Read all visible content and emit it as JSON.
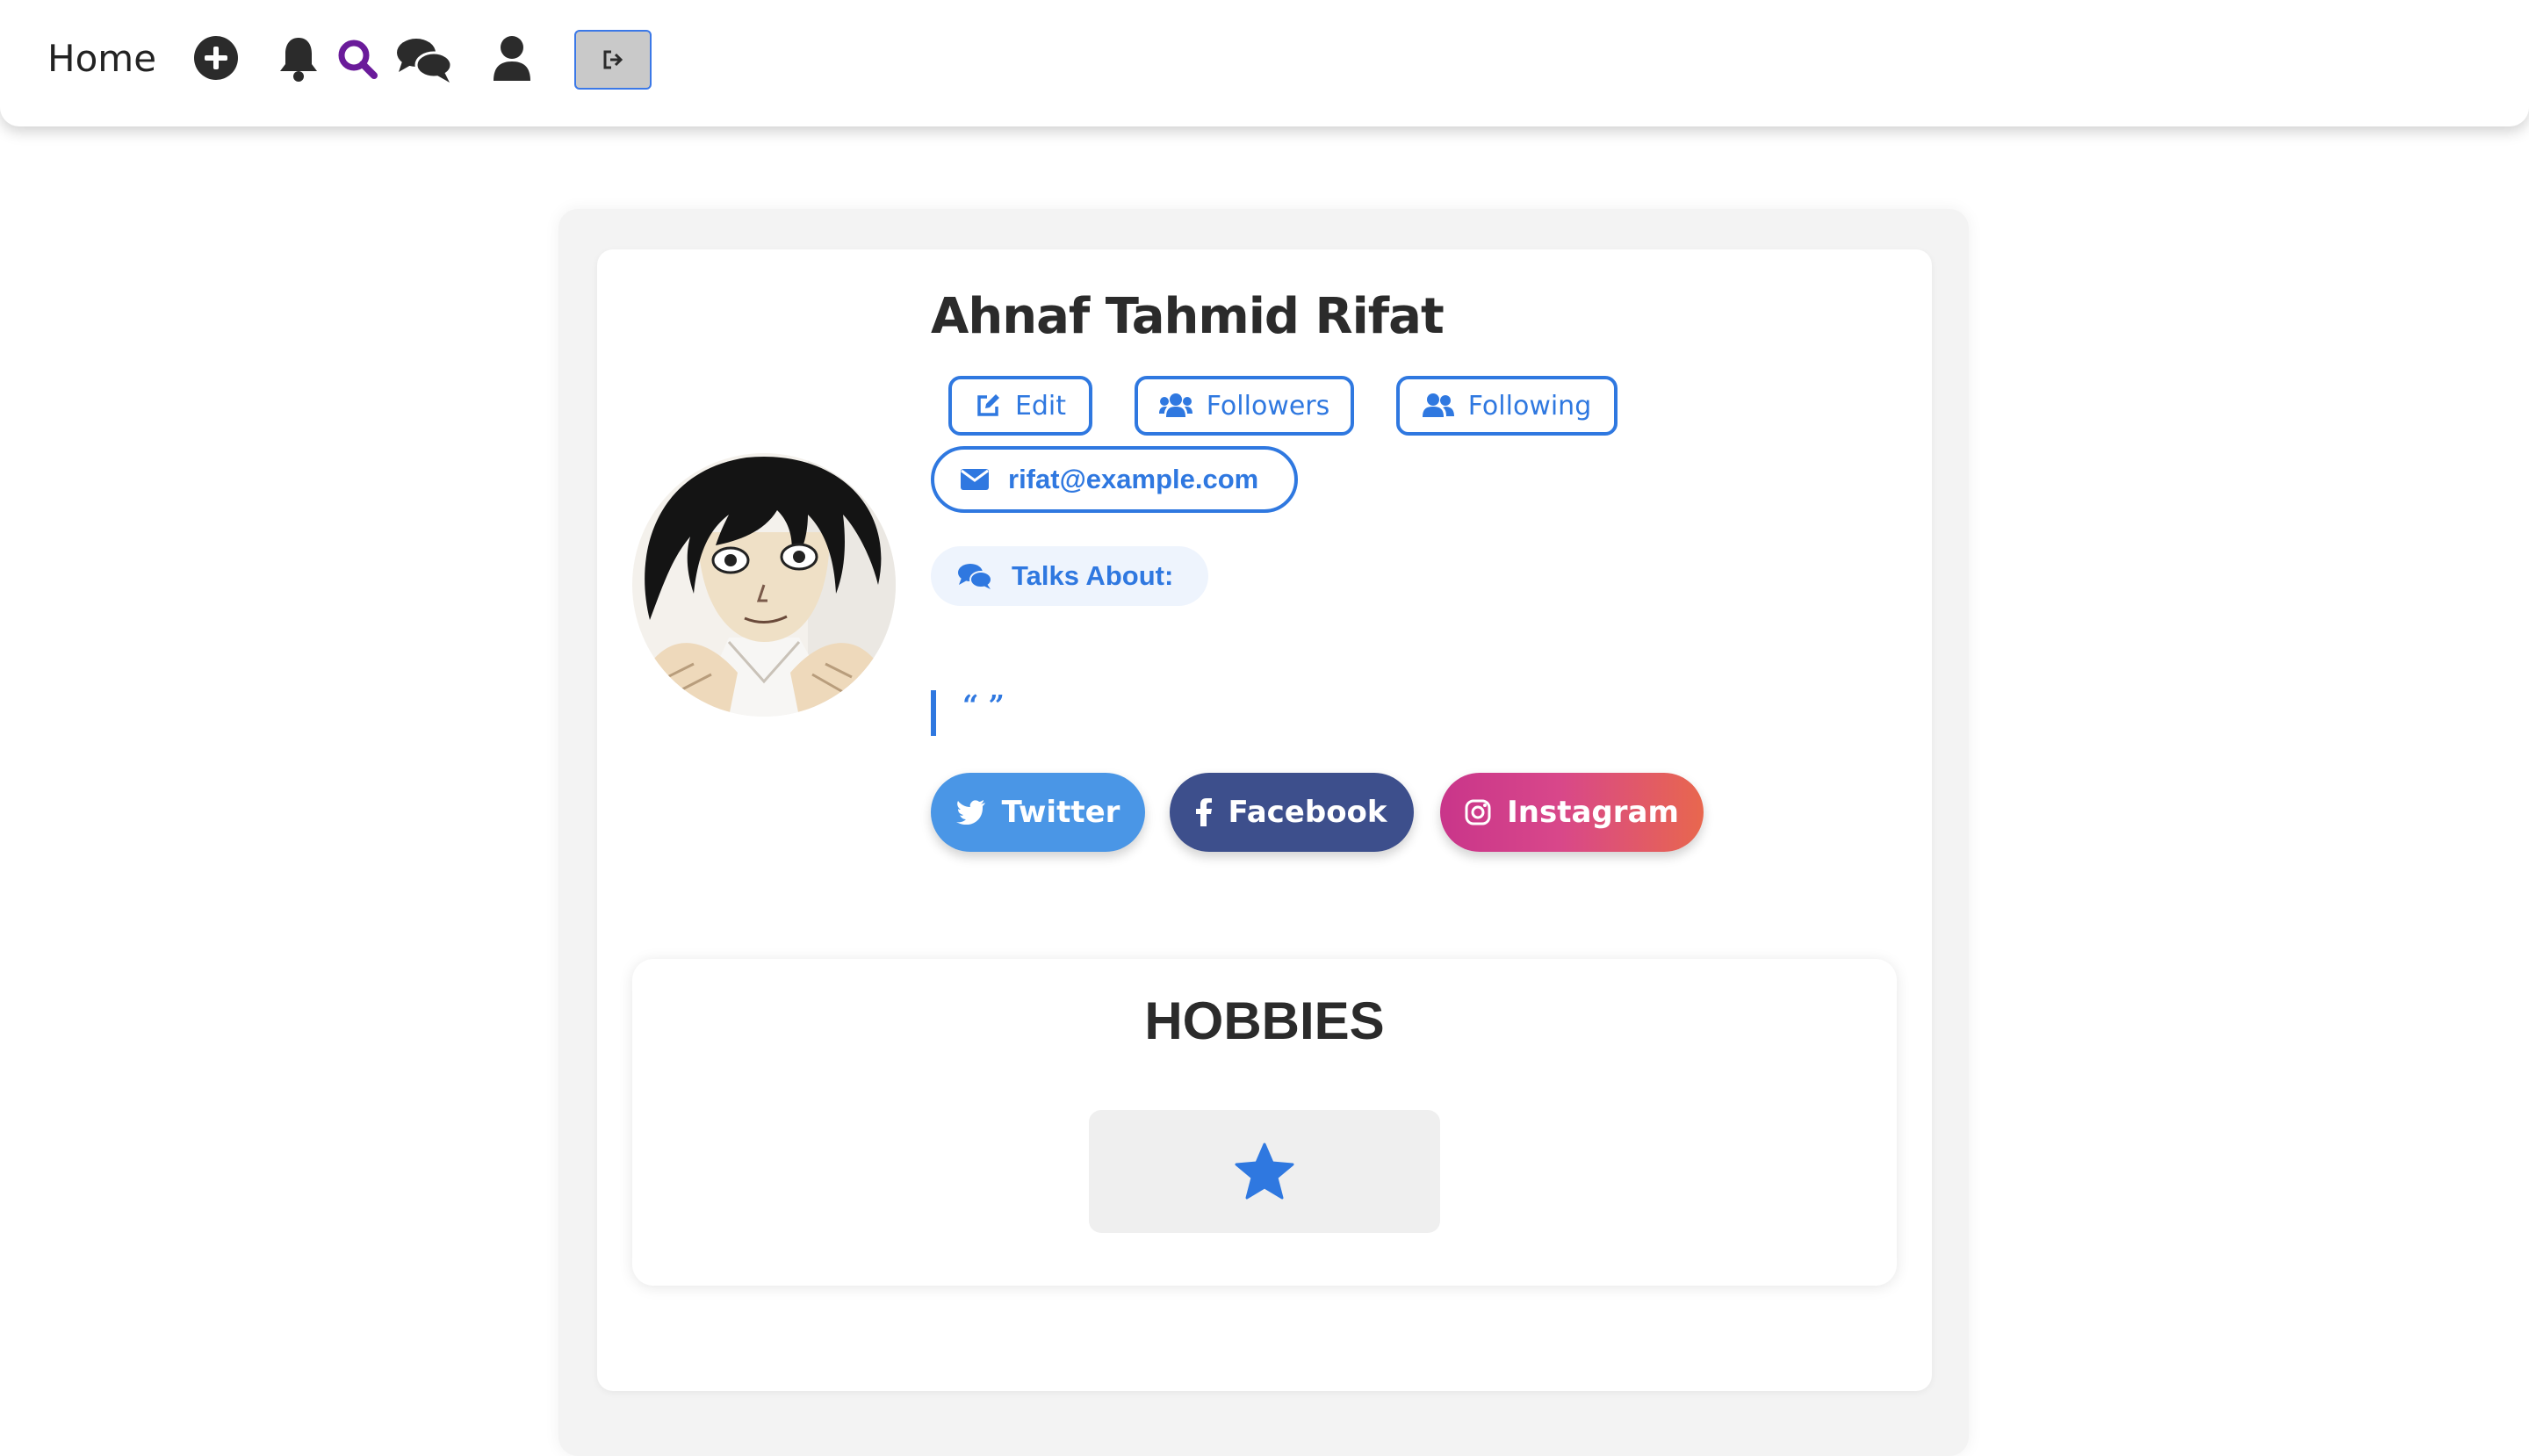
{
  "nav": {
    "home_label": "Home",
    "icons": [
      "add-circle-icon",
      "bell-icon",
      "search-icon",
      "chat-icon",
      "user-icon",
      "logout-icon"
    ],
    "search_color": "#6a1b9a"
  },
  "profile": {
    "name": "Ahnaf Tahmid Rifat",
    "buttons": {
      "edit": "Edit",
      "followers": "Followers",
      "following": "Following"
    },
    "email": "rifat@example.com",
    "talks_about_label": "Talks About:",
    "quote": "“ ”",
    "social": {
      "twitter": "Twitter",
      "facebook": "Facebook",
      "instagram": "Instagram"
    }
  },
  "hobbies": {
    "title": "HOBBIES",
    "items": [
      "star-icon"
    ]
  },
  "colors": {
    "accent": "#2f78e0",
    "twitter": "#4a96e6",
    "facebook": "#3d4f8c",
    "instagram_start": "#c9358a",
    "instagram_end": "#e8674e"
  }
}
